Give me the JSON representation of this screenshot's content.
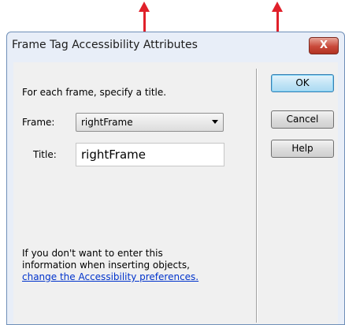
{
  "dialog": {
    "title": "Frame Tag Accessibility Attributes",
    "close_symbol": "X",
    "instruction": "For each frame, specify a title.",
    "frame_label": "Frame:",
    "frame_value": "rightFrame",
    "title_label": "Title:",
    "title_value": "rightFrame",
    "info_line1": "If you don't want to enter this",
    "info_line2": "information when inserting objects,",
    "link_text": "change the Accessibility preferences.",
    "buttons": {
      "ok": "OK",
      "cancel": "Cancel",
      "help": "Help"
    }
  },
  "annotations": {
    "arrow_color": "#e0202a"
  },
  "icons": [
    "close-icon",
    "dropdown-arrow-icon"
  ]
}
